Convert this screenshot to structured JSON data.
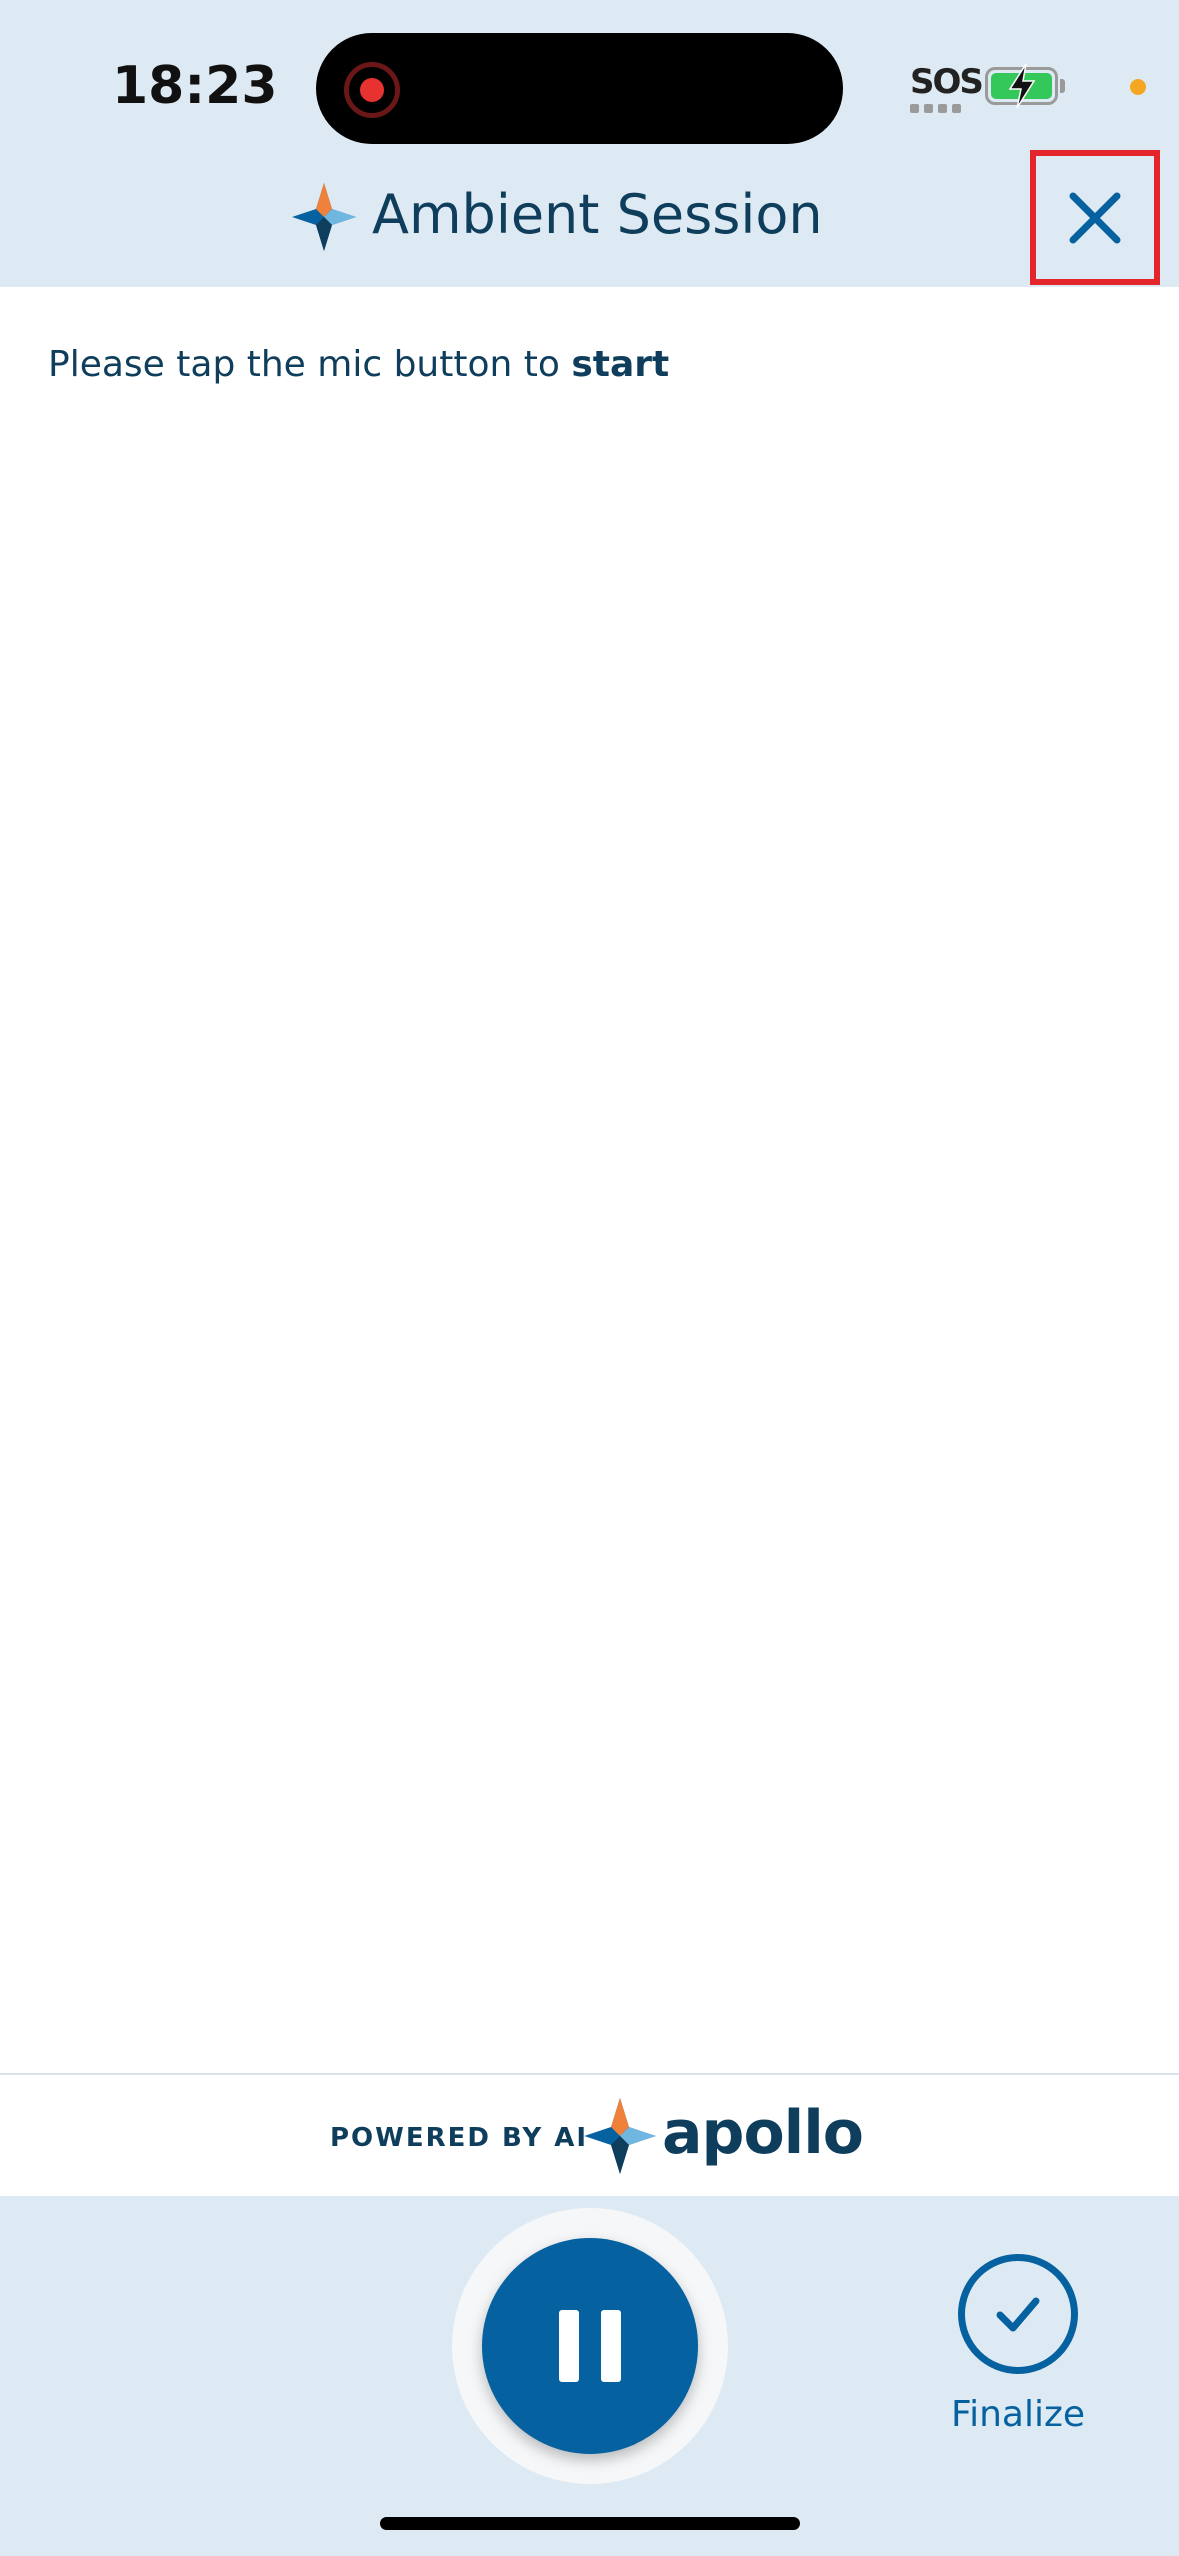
{
  "status_bar": {
    "time": "18:23",
    "sos_label": "SOS",
    "battery_icon": "battery-charging-icon",
    "recording_icon": "screen-record-icon"
  },
  "header": {
    "title": "Ambient Session",
    "logo_icon": "sparkle-star-icon",
    "close_icon": "close-icon"
  },
  "content": {
    "instruction_prefix": "Please tap the mic button to ",
    "instruction_emphasis": "start"
  },
  "footer_brand": {
    "powered_label": "POWERED BY AI",
    "brand_name": "apollo",
    "logo_icon": "sparkle-star-icon"
  },
  "controls": {
    "pause_icon": "pause-icon",
    "finalize_icon": "checkmark-icon",
    "finalize_label": "Finalize"
  },
  "colors": {
    "header_bg": "#deeaf3",
    "primary": "#0561a0",
    "text_dark": "#0f3d5c",
    "highlight_red": "#e3262c",
    "accent_orange": "#f0813a"
  }
}
